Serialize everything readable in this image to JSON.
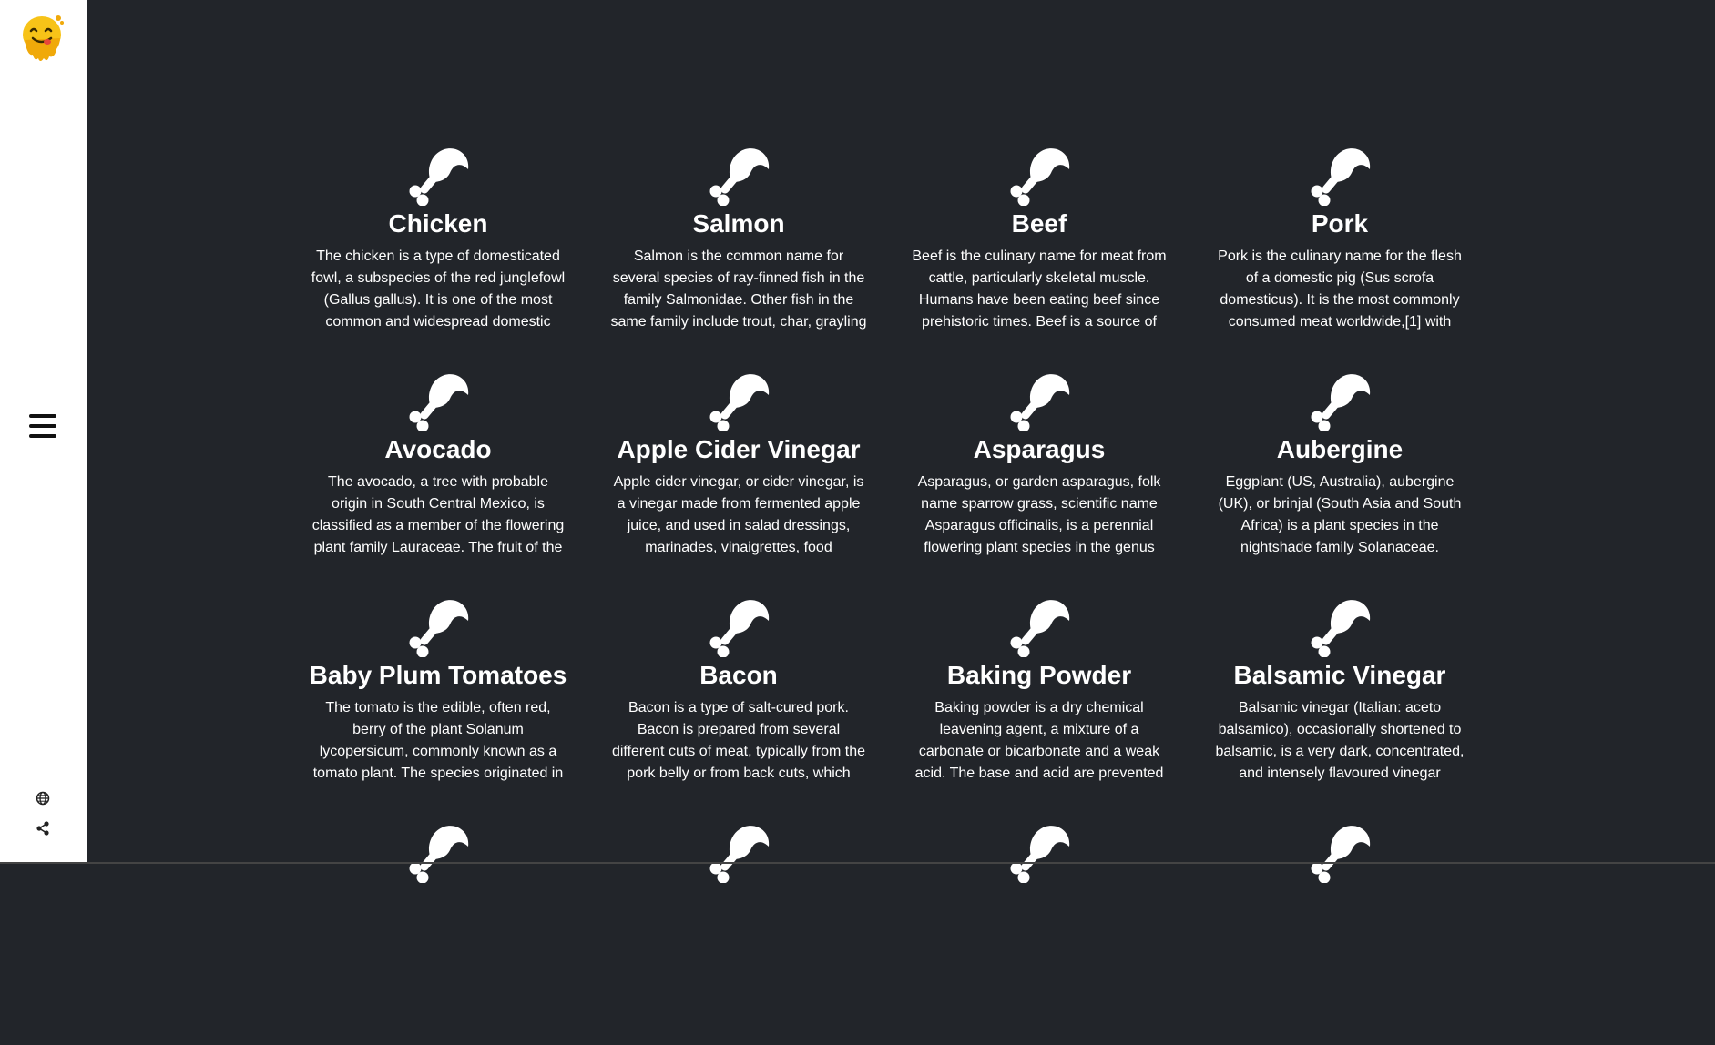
{
  "app": {
    "logo": "emoji-yum-logo",
    "accent": "#f5c518"
  },
  "sidebar": {
    "menu_icon": "hamburger-icon",
    "language_icon": "globe-icon",
    "share_icon": "share-icon"
  },
  "ingredients": [
    {
      "name": "Chicken",
      "description": "The chicken is a type of domesticated fowl, a subspecies of the red junglefowl (Gallus gallus). It is one of the most common and widespread domestic"
    },
    {
      "name": "Salmon",
      "description": "Salmon is the common name for several species of ray-finned fish in the family Salmonidae. Other fish in the same family include trout, char, grayling"
    },
    {
      "name": "Beef",
      "description": "Beef is the culinary name for meat from cattle, particularly skeletal muscle. Humans have been eating beef since prehistoric times. Beef is a source of"
    },
    {
      "name": "Pork",
      "description": "Pork is the culinary name for the flesh of a domestic pig (Sus scrofa domesticus). It is the most commonly consumed meat worldwide,[1] with"
    },
    {
      "name": "Avocado",
      "description": "The avocado, a tree with probable origin in South Central Mexico, is classified as a member of the flowering plant family Lauraceae. The fruit of the"
    },
    {
      "name": "Apple Cider Vinegar",
      "description": "Apple cider vinegar, or cider vinegar, is a vinegar made from fermented apple juice, and used in salad dressings, marinades, vinaigrettes, food"
    },
    {
      "name": "Asparagus",
      "description": "Asparagus, or garden asparagus, folk name sparrow grass, scientific name Asparagus officinalis, is a perennial flowering plant species in the genus"
    },
    {
      "name": "Aubergine",
      "description": "Eggplant (US, Australia), aubergine (UK), or brinjal (South Asia and South Africa) is a plant species in the nightshade family Solanaceae. Solanum"
    },
    {
      "name": "Baby Plum Tomatoes",
      "description": "The tomato is the edible, often red, berry of the plant Solanum lycopersicum, commonly known as a tomato plant. The species originated in"
    },
    {
      "name": "Bacon",
      "description": "Bacon is a type of salt-cured pork. Bacon is prepared from several different cuts of meat, typically from the pork belly or from back cuts, which"
    },
    {
      "name": "Baking Powder",
      "description": "Baking powder is a dry chemical leavening agent, a mixture of a carbonate or bicarbonate and a weak acid. The base and acid are prevented"
    },
    {
      "name": "Balsamic Vinegar",
      "description": "Balsamic vinegar (Italian: aceto balsamico), occasionally shortened to balsamic, is a very dark, concentrated, and intensely flavoured vinegar"
    },
    {
      "name": "",
      "description": ""
    },
    {
      "name": "",
      "description": ""
    },
    {
      "name": "",
      "description": ""
    },
    {
      "name": "",
      "description": ""
    }
  ],
  "card_icon": "drumstick-icon"
}
